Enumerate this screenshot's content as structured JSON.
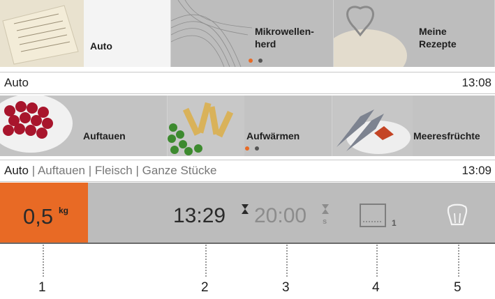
{
  "menu_tiles": [
    {
      "label": "Auto"
    },
    {
      "label": "Mikrowellen-\nherd"
    },
    {
      "label": "Meine\nRezepte"
    }
  ],
  "bar1": {
    "title": "Auto",
    "time": "13:08"
  },
  "category_tiles": [
    {
      "label": "Auftauen"
    },
    {
      "label": "Aufwärmen"
    },
    {
      "label": "Meeresfrüchte"
    }
  ],
  "bar2": {
    "crumbs": [
      "Auto",
      "Auftauen",
      "Fleisch",
      "Ganze Stücke"
    ],
    "separator": "|",
    "time": "13:09"
  },
  "status": {
    "weight": "0,5",
    "weight_unit": "kg",
    "end_time": "13:29",
    "duration": "20:00",
    "duration_unit": "s",
    "level": "1"
  },
  "callouts": [
    "1",
    "2",
    "3",
    "4",
    "5"
  ],
  "colors": {
    "accent": "#e86a25",
    "dot_active": "#e86a25",
    "dot_inactive": "#555555"
  }
}
